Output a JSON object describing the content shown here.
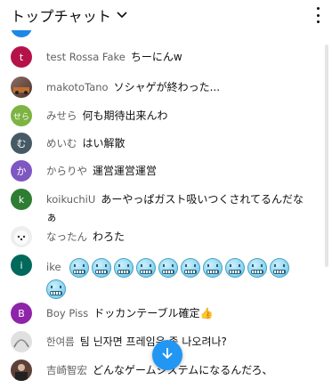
{
  "header": {
    "title": "トップチャット",
    "dropdown_icon": "chevron-down-icon",
    "menu_icon": "more-vert-icon"
  },
  "messages": [
    {
      "avatar_letter": "t",
      "avatar_color": "#b5124a",
      "author": "test Rossa Fake",
      "text": "ちーにんw"
    },
    {
      "avatar_letter": "",
      "avatar_color": "#7a4a2b",
      "author": "makotoTano",
      "text": "ソシャゲが終わった..."
    },
    {
      "avatar_letter": "せら",
      "avatar_color": "#7cb342",
      "author": "みせら",
      "text": "何も期待出来んわ"
    },
    {
      "avatar_letter": "む",
      "avatar_color": "#455a64",
      "author": "めいむ",
      "text": "はい解散"
    },
    {
      "avatar_letter": "か",
      "avatar_color": "#7e57c2",
      "author": "からりや",
      "text": "運営運営運営"
    },
    {
      "avatar_letter": "k",
      "avatar_color": "#2e7d32",
      "author": "koikuchiU",
      "text": "あーやっぱガスト吸いつくされてるんだなぁ"
    },
    {
      "avatar_letter": "",
      "avatar_color": "#e0e0e0",
      "author": "なったん",
      "text": "わろた"
    },
    {
      "avatar_letter": "i",
      "avatar_color": "#00695c",
      "author": "ike",
      "text": "",
      "emoji_count": 11
    },
    {
      "avatar_letter": "B",
      "avatar_color": "#8e24aa",
      "author": "Boy Piss",
      "text": "ドッカンテーブル確定👍"
    },
    {
      "avatar_letter": "",
      "avatar_color": "#9e9e9e",
      "author": "한여름",
      "text": "팀 닌자면 프레임은 좀 나오려나?"
    },
    {
      "avatar_letter": "",
      "avatar_color": "#5d4037",
      "author": "吉崎智宏",
      "text": "どんなゲームシステムになるんだろ、"
    }
  ],
  "scroll_button_icon": "arrow-down-icon",
  "accent_color": "#2196f3"
}
